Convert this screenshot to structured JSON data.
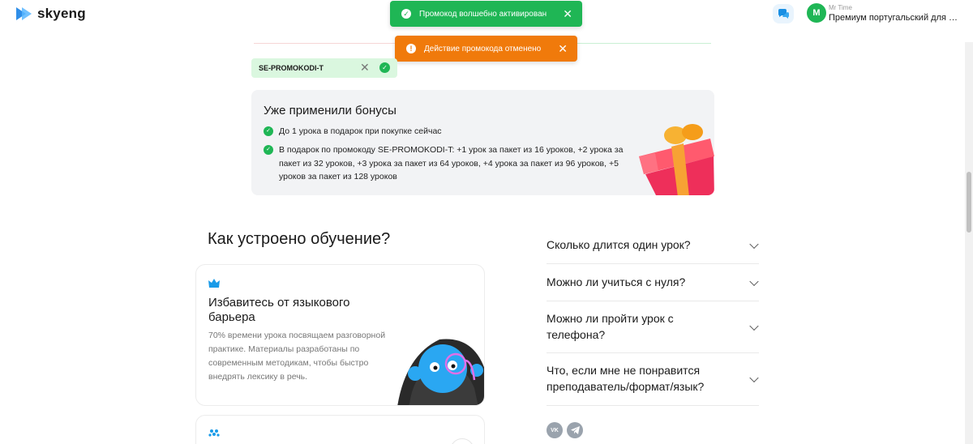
{
  "header": {
    "logo_text": "skyeng",
    "user_name": "Mr Time",
    "user_avatar_letter": "M",
    "user_plan": "Премиум португальский для взрослых",
    "chat_icon": "chat-bubbles-icon"
  },
  "toasts": {
    "success_text": "Промокод волшебно активирован",
    "warning_text": "Действие промокода отменено",
    "close_label": "✕"
  },
  "promo": {
    "code": "SE-PROMOKODI-T",
    "remove_label": "✕"
  },
  "bonuses": {
    "title": "Уже применили бонусы",
    "items": [
      "До 1 урока в подарок при покупке сейчас",
      "В подарок по промокоду SE-PROMOKODI-T: +1 урок за пакет из 16 уроков, +2 урока за пакет из 32 уроков, +3 урока за пакет из 64 уроков, +4 урока за пакет из 96 уроков, +5 уроков за пакет из 128 уроков"
    ]
  },
  "learning": {
    "title": "Как устроено обучение?",
    "card1_title": "Избавитесь от языкового барьера",
    "card1_desc": "70% времени урока посвящаем разговорной практике. Материалы разработаны по современным методикам, чтобы быстро внедрять лексику в речь."
  },
  "faq": [
    "Сколько длится один урок?",
    "Можно ли учиться с нуля?",
    "Можно ли пройти урок с телефона?",
    "Что, если мне не понравится преподаватель/формат/язык?"
  ],
  "social": {
    "vk": "VK"
  },
  "colors": {
    "success": "#1fb655",
    "warning": "#f07a0b",
    "brand": "#1a8fe3"
  }
}
